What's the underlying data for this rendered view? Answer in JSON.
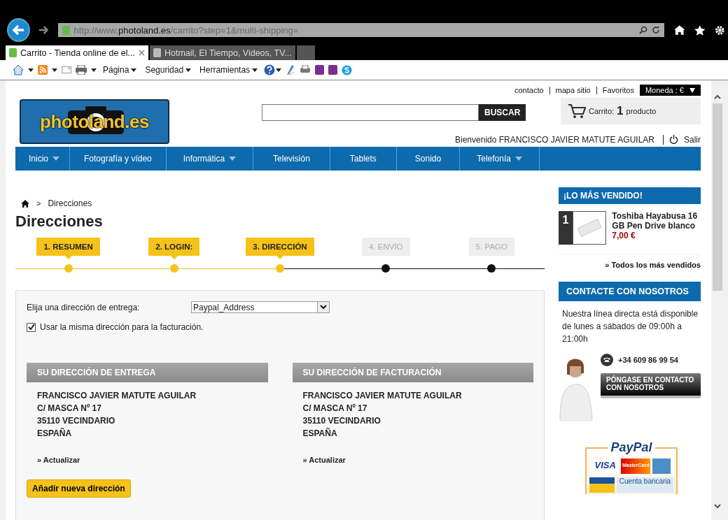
{
  "browser": {
    "address": {
      "prefix": "http://www.",
      "domain": "photoland.es",
      "path": "/carrito?step=1&multi-shipping="
    },
    "tabs": [
      {
        "title": "Carrito - Tienda online de el...",
        "selected": true
      },
      {
        "title": "Hotmail, El Tiempo, Videos, TV...",
        "selected": false
      }
    ],
    "menus": [
      "Página",
      "Seguridad",
      "Herramientas"
    ]
  },
  "header": {
    "top_links": [
      "contacto",
      "mapa sitio",
      "Favoritos"
    ],
    "currency": "Moneda : €",
    "logo": "photoland.es",
    "search_button": "BUSCAR",
    "cart": {
      "label": "Carrito:",
      "count": "1",
      "unit": "producto"
    },
    "welcome": "Bienvenido FRANCISCO JAVIER MATUTE AGUILAR",
    "logout": "Salir"
  },
  "nav": [
    {
      "label": "Inicio",
      "has_menu": true
    },
    {
      "label": "Fotografía y vídeo",
      "has_menu": false
    },
    {
      "label": "Informática",
      "has_menu": true
    },
    {
      "label": "Televisión",
      "has_menu": false
    },
    {
      "label": "Tablets",
      "has_menu": false
    },
    {
      "label": "Sonido",
      "has_menu": false
    },
    {
      "label": "Telefonía",
      "has_menu": true
    }
  ],
  "breadcrumb_separator": ">",
  "breadcrumb": "Direcciones",
  "title": "Direcciones",
  "steps": [
    {
      "label": "1. RESUMEN",
      "reached": true
    },
    {
      "label": "2. LOGIN:",
      "reached": true
    },
    {
      "label": "3. DIRECCIÓN",
      "reached": true
    },
    {
      "label": "4. ENVÍO",
      "reached": false
    },
    {
      "label": "5. PAGO",
      "reached": false
    }
  ],
  "form": {
    "select_label": "Elija una dirección de entrega:",
    "select_value": "Paypal_Address",
    "checkbox": {
      "label": "Usar la misma dirección para la facturación.",
      "checked": true
    },
    "addresses": [
      {
        "heading": "SU DIRECCIÓN DE ENTREGA",
        "lines": [
          "FRANCISCO JAVIER MATUTE AGUILAR",
          "C/ MASCA Nº 17",
          "35110 VECINDARIO",
          "ESPAÑA"
        ],
        "link": "» Actualizar"
      },
      {
        "heading": "SU DIRECCIÓN DE FACTURACIÓN",
        "lines": [
          "FRANCISCO JAVIER MATUTE AGUILAR",
          "C/ MASCA Nº 17",
          "35110 VECINDARIO",
          "ESPAÑA"
        ],
        "link": "» Actualizar"
      }
    ],
    "add_button": "Añadir nueva dirección"
  },
  "sidebar": {
    "bestsellers": {
      "heading": "¡LO MÁS VENDIDO!",
      "items": [
        {
          "rank": "1",
          "name": "Toshiba Hayabusa 16 GB Pen Drive blanco",
          "price": "7,00 €"
        }
      ],
      "more_link": "» Todos los más vendidos"
    },
    "contact": {
      "heading": "CONTACTE CON NOSOTROS",
      "text": "Nuestra línea directa está disponible de lunes a sábados de 09:00h a 21:00h",
      "phone": "+34 609 86 99 54",
      "button": "PÓNGASE EN CONTACTO CON NOSOTROS"
    },
    "payments": {
      "logo": "PayPal",
      "visa": "VISA",
      "mastercard": "MasterCard",
      "bank": "Cuenta bancaria"
    }
  }
}
